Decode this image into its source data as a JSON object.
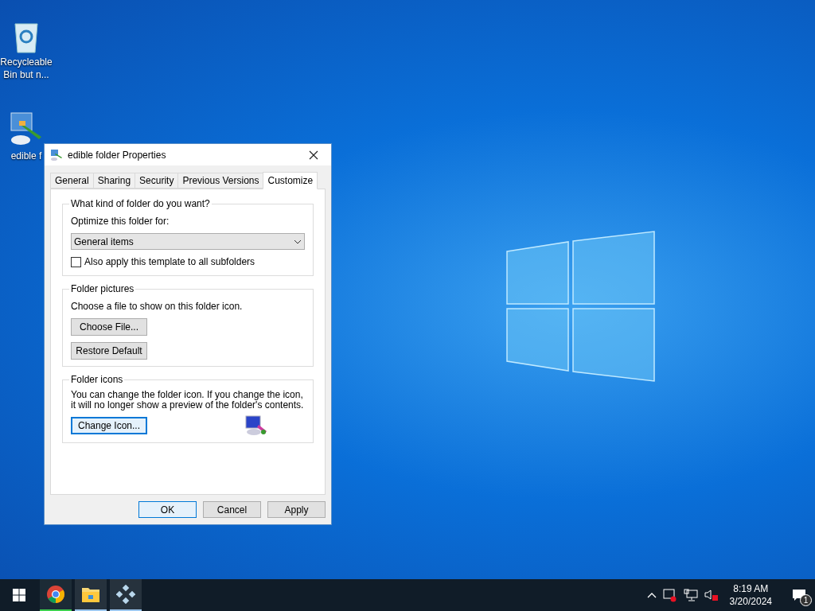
{
  "desktop_icons": [
    {
      "kind": "recycle",
      "label": "Recycleable Bin but n..."
    },
    {
      "kind": "paint",
      "label": "edible f"
    }
  ],
  "dialog": {
    "title": "edible folder Properties",
    "tabs": [
      {
        "label": "General",
        "selected": false
      },
      {
        "label": "Sharing",
        "selected": false
      },
      {
        "label": "Security",
        "selected": false
      },
      {
        "label": "Previous Versions",
        "selected": false
      },
      {
        "label": "Customize",
        "selected": true
      }
    ],
    "kind_group": {
      "title": "What kind of folder do you want?",
      "optimize_label": "Optimize this folder for:",
      "dropdown_value": "General items",
      "subfolders_checkbox": {
        "label": "Also apply this template to all subfolders",
        "checked": false
      }
    },
    "pictures_group": {
      "title": "Folder pictures",
      "description": "Choose a file to show on this folder icon.",
      "buttons": [
        "Choose File...",
        "Restore Default"
      ]
    },
    "icons_group": {
      "title": "Folder icons",
      "description": "You can change the folder icon. If you change the icon, it will no longer show a preview of the folder's contents.",
      "button": "Change Icon..."
    },
    "buttons": [
      {
        "label": "OK",
        "selected": true
      },
      {
        "label": "Cancel",
        "selected": false
      },
      {
        "label": "Apply",
        "selected": false
      }
    ]
  },
  "taskbar": {
    "apps": [
      {
        "kind": "chrome",
        "active": true
      },
      {
        "kind": "explorer",
        "active": false
      },
      {
        "kind": "game",
        "active": false
      }
    ],
    "time": "8:19 AM",
    "date": "3/20/2024",
    "notification_count": "1"
  }
}
